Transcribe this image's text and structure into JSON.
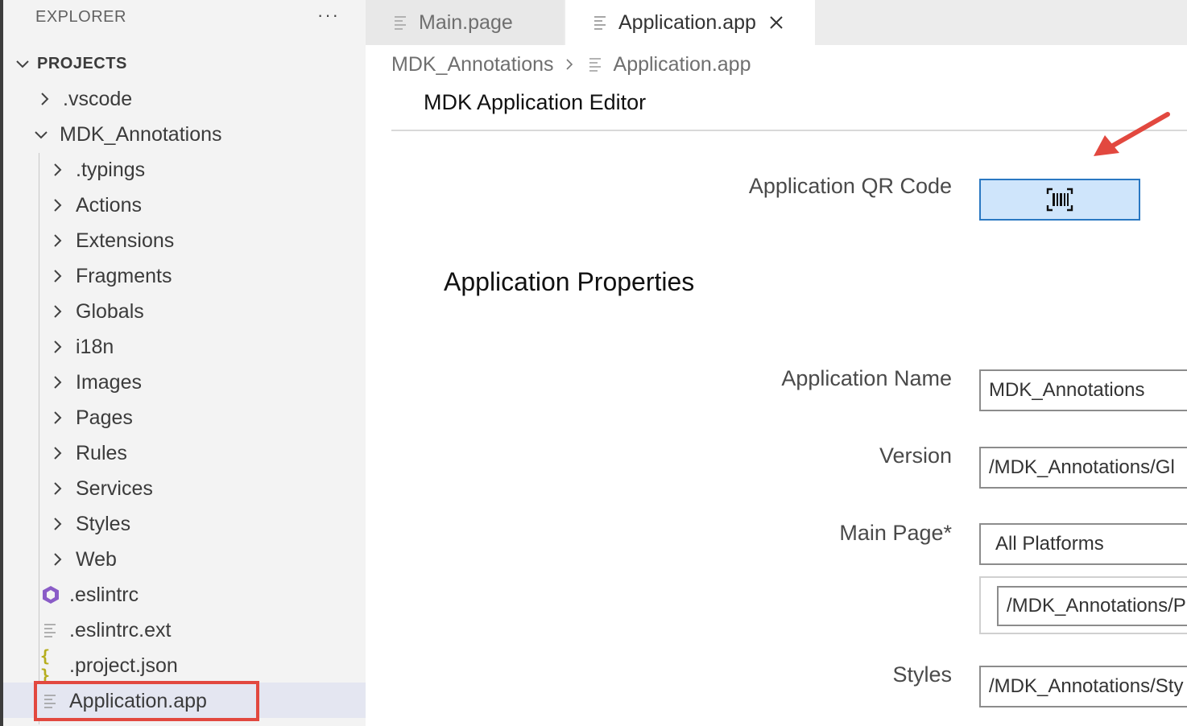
{
  "explorer": {
    "title": "EXPLORER",
    "more_icon": "ellipsis-icon",
    "section": "PROJECTS",
    "items": [
      {
        "label": ".vscode",
        "type": "folder"
      },
      {
        "label": "MDK_Annotations",
        "type": "folder-open"
      },
      {
        "label": ".typings",
        "type": "folder"
      },
      {
        "label": "Actions",
        "type": "folder"
      },
      {
        "label": "Extensions",
        "type": "folder"
      },
      {
        "label": "Fragments",
        "type": "folder"
      },
      {
        "label": "Globals",
        "type": "folder"
      },
      {
        "label": "i18n",
        "type": "folder"
      },
      {
        "label": "Images",
        "type": "folder"
      },
      {
        "label": "Pages",
        "type": "folder"
      },
      {
        "label": "Rules",
        "type": "folder"
      },
      {
        "label": "Services",
        "type": "folder"
      },
      {
        "label": "Styles",
        "type": "folder"
      },
      {
        "label": "Web",
        "type": "folder"
      },
      {
        "label": ".eslintrc",
        "type": "eslint-file"
      },
      {
        "label": ".eslintrc.ext",
        "type": "text-file"
      },
      {
        "label": ".project.json",
        "type": "json-file"
      },
      {
        "label": "Application.app",
        "type": "text-file",
        "selected": true
      }
    ]
  },
  "tabs": [
    {
      "label": "Main.page",
      "active": false
    },
    {
      "label": "Application.app",
      "active": true
    }
  ],
  "breadcrumb": {
    "folder": "MDK_Annotations",
    "file": "Application.app"
  },
  "editor": {
    "title": "MDK Application Editor",
    "qr_label": "Application QR Code",
    "qr_icon": "barcode-icon",
    "section_title": "Application Properties",
    "fields": {
      "app_name_label": "Application Name",
      "app_name_value": "MDK_Annotations",
      "version_label": "Version",
      "version_value": "/MDK_Annotations/Gl",
      "main_page_label": "Main Page*",
      "main_page_platform": "All Platforms",
      "main_page_value": "/MDK_Annotations/P",
      "styles_label": "Styles",
      "styles_value": "/MDK_Annotations/Sty"
    }
  },
  "colors": {
    "highlight_box": "#e2483f",
    "qr_button_bg": "#cfe5fb",
    "qr_button_border": "#2a78c2",
    "sidebar_bg": "#f3f3f3",
    "selected_row": "#e4e6f1"
  }
}
